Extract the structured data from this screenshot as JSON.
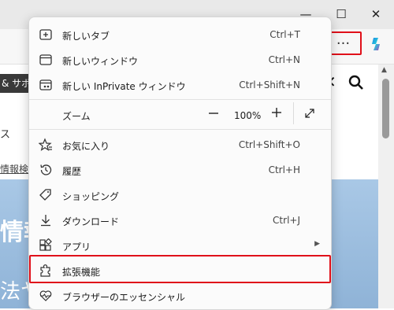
{
  "window": {
    "minimize_glyph": "—",
    "maximize_glyph": "☐",
    "close_glyph": "✕"
  },
  "toolbar": {
    "more_glyph": "···"
  },
  "page": {
    "nav_dark": "& サポ",
    "nav_text": "ス",
    "link_text": "情報検索",
    "hero_line1": "情報",
    "hero_line2": "法ヤ"
  },
  "menu": {
    "new_tab": {
      "label": "新しいタブ",
      "shortcut": "Ctrl+T"
    },
    "new_window": {
      "label": "新しいウィンドウ",
      "shortcut": "Ctrl+N"
    },
    "new_inprivate": {
      "label": "新しい InPrivate ウィンドウ",
      "shortcut": "Ctrl+Shift+N"
    },
    "zoom": {
      "label": "ズーム",
      "value": "100%",
      "minus": "—",
      "plus": "+"
    },
    "favorites": {
      "label": "お気に入り",
      "shortcut": "Ctrl+Shift+O"
    },
    "history": {
      "label": "履歴",
      "shortcut": "Ctrl+H"
    },
    "shopping": {
      "label": "ショッピング",
      "shortcut": ""
    },
    "downloads": {
      "label": "ダウンロード",
      "shortcut": "Ctrl+J"
    },
    "apps": {
      "label": "アプリ",
      "shortcut": ""
    },
    "extensions": {
      "label": "拡張機能",
      "shortcut": ""
    },
    "essentials": {
      "label": "ブラウザーのエッセンシャル",
      "shortcut": ""
    }
  },
  "colors": {
    "highlight": "#e0101a",
    "hero": "#a9c8e6"
  }
}
